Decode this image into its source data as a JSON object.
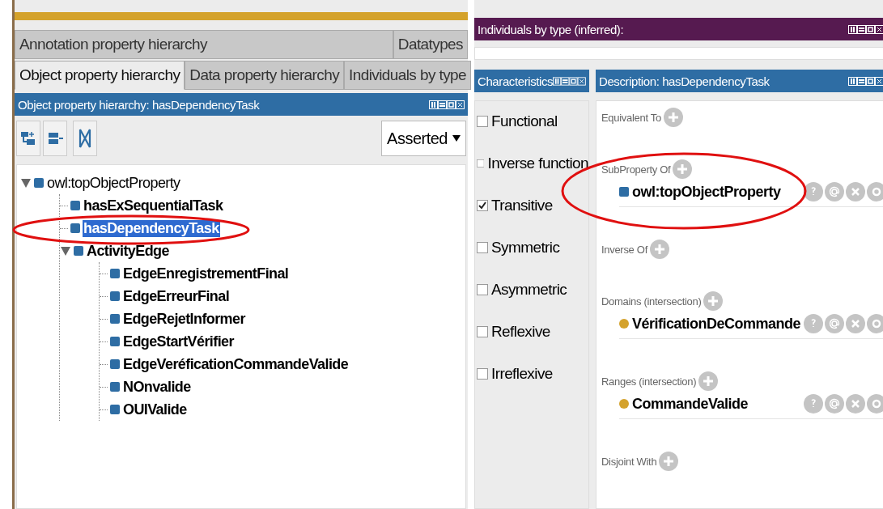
{
  "left_panel": {
    "tab_rows": [
      [
        {
          "label": "Annotation property hierarchy",
          "selected": false
        },
        {
          "label": "Datatypes",
          "selected": false
        }
      ],
      [
        {
          "label": "Object property hierarchy",
          "selected": true
        },
        {
          "label": "Data property hierarchy",
          "selected": false
        },
        {
          "label": "Individuals by type",
          "selected": false
        }
      ]
    ],
    "view_title": "Object property hierarchy: hasDependencyTask",
    "mode_dropdown": "Asserted",
    "tree": [
      {
        "label": "owl:topObjectProperty",
        "expanded": true,
        "selected": false,
        "children": [
          {
            "label": "hasExSequentialTask",
            "selected": false
          },
          {
            "label": "hasDependencyTask",
            "selected": true
          },
          {
            "label": "ActivityEdge",
            "expanded": true,
            "selected": false,
            "children": [
              {
                "label": "EdgeEnregistrementFinal",
                "selected": false
              },
              {
                "label": "EdgeErreurFinal",
                "selected": false
              },
              {
                "label": "EdgeRejetInformer",
                "selected": false
              },
              {
                "label": "EdgeStartVérifier",
                "selected": false
              },
              {
                "label": "EdgeVeréficationCommandeValide",
                "selected": false
              },
              {
                "label": "NOnvalide",
                "selected": false
              },
              {
                "label": "OUIValide",
                "selected": false
              }
            ]
          }
        ]
      }
    ]
  },
  "individuals_view": {
    "title": "Individuals by type (inferred):"
  },
  "characteristics": {
    "title": "Characteristics",
    "items": [
      {
        "label": "Functional",
        "checked": false
      },
      {
        "label": "Inverse function",
        "checked": false
      },
      {
        "label": "Transitive",
        "checked": true
      },
      {
        "label": "Symmetric",
        "checked": false
      },
      {
        "label": "Asymmetric",
        "checked": false
      },
      {
        "label": "Reflexive",
        "checked": false
      },
      {
        "label": "Irreflexive",
        "checked": false
      }
    ]
  },
  "description": {
    "title": "Description: hasDependencyTask",
    "sections": [
      {
        "title": "Equivalent To"
      },
      {
        "title": "SubProperty Of",
        "items": [
          {
            "label": "owl:topObjectProperty",
            "kind": "property"
          }
        ]
      },
      {
        "title": "Inverse Of"
      },
      {
        "title": "Domains (intersection)",
        "items": [
          {
            "label": "VérificationDeCommande",
            "kind": "class"
          }
        ]
      },
      {
        "title": "Ranges (intersection)",
        "items": [
          {
            "label": "CommandeValide",
            "kind": "class"
          }
        ]
      },
      {
        "title": "Disjoint With"
      }
    ]
  }
}
